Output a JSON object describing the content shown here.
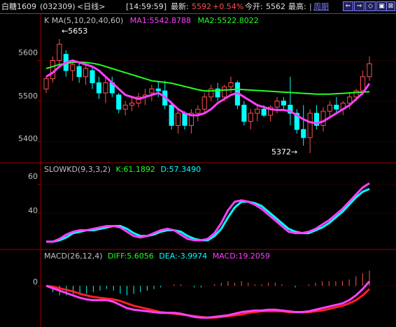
{
  "header": {
    "symbol": "白糖1609",
    "code": "(032309)",
    "period": "<日线>",
    "time": "[14:59:59]",
    "last_label": "最新:",
    "last_value": "5592",
    "change": "+0.54%",
    "open_label": "今开:",
    "open_value": "5562",
    "high_label": "最高:",
    "cycle_label": "周期",
    "buttons": [
      "⇐",
      "⇒",
      "◇",
      "▣",
      "⊠"
    ]
  },
  "colors": {
    "up": "#ff5050",
    "down": "#00ffff",
    "ma1": "#ff40ff",
    "ma2": "#22ff22",
    "grid": "#7a0000"
  },
  "kline": {
    "title": "K  MA(5,10,20,40,60)",
    "ma1": "MA1:5542.8788",
    "ma2": "MA2:5522.8022",
    "y_ticks": [
      "5600",
      "5500",
      "5400"
    ],
    "max_label": "←5653",
    "min_label": "5372→"
  },
  "kd": {
    "title": "SLOWKD(9,3,3,2)",
    "k": "K:61.1892",
    "d": "D:57.3490",
    "y_ticks": [
      "60",
      "40"
    ]
  },
  "macd": {
    "title": "MACD(26,12,4)",
    "diff": "DIFF:5.6056",
    "dea": "DEA:-3.9974",
    "macd": "MACD:19.2059",
    "y_ticks": [
      "0"
    ]
  },
  "chart_data": [
    {
      "type": "candlestick",
      "title": "K  MA(5,10,20,40,60)",
      "ylim": [
        5360,
        5680
      ],
      "candles": [
        {
          "o": 5530,
          "h": 5560,
          "l": 5520,
          "c": 5555
        },
        {
          "o": 5555,
          "h": 5610,
          "l": 5545,
          "c": 5600
        },
        {
          "o": 5600,
          "h": 5653,
          "l": 5585,
          "c": 5640
        },
        {
          "o": 5615,
          "h": 5625,
          "l": 5560,
          "c": 5575
        },
        {
          "o": 5575,
          "h": 5600,
          "l": 5550,
          "c": 5590
        },
        {
          "o": 5585,
          "h": 5595,
          "l": 5545,
          "c": 5560
        },
        {
          "o": 5560,
          "h": 5590,
          "l": 5540,
          "c": 5580
        },
        {
          "o": 5575,
          "h": 5585,
          "l": 5530,
          "c": 5545
        },
        {
          "o": 5545,
          "h": 5560,
          "l": 5505,
          "c": 5520
        },
        {
          "o": 5520,
          "h": 5560,
          "l": 5495,
          "c": 5545
        },
        {
          "o": 5545,
          "h": 5560,
          "l": 5510,
          "c": 5520
        },
        {
          "o": 5515,
          "h": 5520,
          "l": 5470,
          "c": 5480
        },
        {
          "o": 5480,
          "h": 5500,
          "l": 5465,
          "c": 5490
        },
        {
          "o": 5490,
          "h": 5510,
          "l": 5475,
          "c": 5495
        },
        {
          "o": 5495,
          "h": 5520,
          "l": 5485,
          "c": 5510
        },
        {
          "o": 5510,
          "h": 5530,
          "l": 5490,
          "c": 5515
        },
        {
          "o": 5520,
          "h": 5540,
          "l": 5500,
          "c": 5530
        },
        {
          "o": 5530,
          "h": 5550,
          "l": 5510,
          "c": 5525
        },
        {
          "o": 5525,
          "h": 5550,
          "l": 5480,
          "c": 5490
        },
        {
          "o": 5490,
          "h": 5500,
          "l": 5430,
          "c": 5440
        },
        {
          "o": 5440,
          "h": 5480,
          "l": 5420,
          "c": 5470
        },
        {
          "o": 5470,
          "h": 5475,
          "l": 5430,
          "c": 5440
        },
        {
          "o": 5440,
          "h": 5480,
          "l": 5420,
          "c": 5470
        },
        {
          "o": 5470,
          "h": 5490,
          "l": 5450,
          "c": 5480
        },
        {
          "o": 5480,
          "h": 5520,
          "l": 5470,
          "c": 5510
        },
        {
          "o": 5510,
          "h": 5540,
          "l": 5500,
          "c": 5530
        },
        {
          "o": 5530,
          "h": 5545,
          "l": 5500,
          "c": 5510
        },
        {
          "o": 5510,
          "h": 5540,
          "l": 5500,
          "c": 5535
        },
        {
          "o": 5535,
          "h": 5560,
          "l": 5520,
          "c": 5545
        },
        {
          "o": 5545,
          "h": 5550,
          "l": 5480,
          "c": 5490
        },
        {
          "o": 5490,
          "h": 5500,
          "l": 5440,
          "c": 5450
        },
        {
          "o": 5450,
          "h": 5480,
          "l": 5430,
          "c": 5470
        },
        {
          "o": 5470,
          "h": 5490,
          "l": 5450,
          "c": 5480
        },
        {
          "o": 5480,
          "h": 5490,
          "l": 5460,
          "c": 5465
        },
        {
          "o": 5465,
          "h": 5490,
          "l": 5450,
          "c": 5485
        },
        {
          "o": 5485,
          "h": 5510,
          "l": 5470,
          "c": 5500
        },
        {
          "o": 5500,
          "h": 5510,
          "l": 5480,
          "c": 5490
        },
        {
          "o": 5490,
          "h": 5560,
          "l": 5440,
          "c": 5470
        },
        {
          "o": 5470,
          "h": 5480,
          "l": 5420,
          "c": 5430
        },
        {
          "o": 5430,
          "h": 5490,
          "l": 5390,
          "c": 5410
        },
        {
          "o": 5410,
          "h": 5480,
          "l": 5372,
          "c": 5470
        },
        {
          "o": 5470,
          "h": 5490,
          "l": 5430,
          "c": 5440
        },
        {
          "o": 5440,
          "h": 5485,
          "l": 5425,
          "c": 5475
        },
        {
          "o": 5475,
          "h": 5500,
          "l": 5460,
          "c": 5490
        },
        {
          "o": 5490,
          "h": 5510,
          "l": 5470,
          "c": 5480
        },
        {
          "o": 5480,
          "h": 5500,
          "l": 5465,
          "c": 5495
        },
        {
          "o": 5495,
          "h": 5520,
          "l": 5480,
          "c": 5510
        },
        {
          "o": 5510,
          "h": 5530,
          "l": 5500,
          "c": 5525
        },
        {
          "o": 5525,
          "h": 5575,
          "l": 5515,
          "c": 5560
        },
        {
          "o": 5560,
          "h": 5610,
          "l": 5550,
          "c": 5592
        }
      ],
      "ma1": [
        5560,
        5570,
        5585,
        5595,
        5600,
        5595,
        5590,
        5585,
        5575,
        5560,
        5545,
        5530,
        5515,
        5510,
        5505,
        5510,
        5515,
        5520,
        5510,
        5495,
        5480,
        5470,
        5465,
        5465,
        5470,
        5480,
        5495,
        5505,
        5515,
        5520,
        5510,
        5500,
        5490,
        5485,
        5480,
        5478,
        5478,
        5475,
        5465,
        5455,
        5448,
        5445,
        5450,
        5460,
        5470,
        5480,
        5490,
        5505,
        5520,
        5543
      ],
      "ma2": [
        5580,
        5585,
        5590,
        5592,
        5595,
        5596,
        5595,
        5593,
        5590,
        5585,
        5580,
        5575,
        5570,
        5565,
        5560,
        5555,
        5550,
        5548,
        5546,
        5544,
        5540,
        5536,
        5532,
        5528,
        5525,
        5525,
        5526,
        5527,
        5528,
        5529,
        5528,
        5527,
        5526,
        5525,
        5524,
        5523,
        5522,
        5521,
        5520,
        5519,
        5518,
        5517,
        5517,
        5517,
        5518,
        5519,
        5520,
        5521,
        5522,
        5523
      ]
    },
    {
      "type": "line",
      "title": "SLOWKD(9,3,3,2)",
      "ylim": [
        17,
        67
      ],
      "series": [
        {
          "name": "K",
          "values": [
            20,
            20,
            22,
            25,
            27,
            28,
            28,
            29,
            30,
            31,
            31,
            30,
            27,
            24,
            23,
            24,
            26,
            28,
            29,
            28,
            25,
            22,
            21,
            21,
            22,
            26,
            33,
            42,
            48,
            49,
            48,
            46,
            43,
            39,
            35,
            31,
            27,
            26,
            26,
            27,
            29,
            32,
            35,
            39,
            43,
            48,
            53,
            58,
            61
          ]
        },
        {
          "name": "D",
          "values": [
            20,
            20,
            21,
            23,
            26,
            27,
            28,
            28,
            29,
            30,
            31,
            31,
            29,
            26,
            24,
            24,
            25,
            27,
            28,
            28,
            27,
            24,
            22,
            21,
            21,
            24,
            29,
            37,
            44,
            48,
            48,
            47,
            45,
            41,
            37,
            33,
            29,
            27,
            26,
            26,
            28,
            30,
            33,
            37,
            41,
            46,
            51,
            55,
            57
          ]
        }
      ]
    },
    {
      "type": "line",
      "title": "MACD(26,12,4)",
      "ylim": [
        -50,
        30
      ],
      "series": [
        {
          "name": "DIFF",
          "values": [
            0,
            -3,
            -6,
            -9,
            -12,
            -15,
            -17,
            -18,
            -18,
            -18,
            -20,
            -24,
            -28,
            -30,
            -31,
            -32,
            -33,
            -34,
            -34,
            -34,
            -35,
            -37,
            -39,
            -40,
            -40,
            -39,
            -38,
            -37,
            -35,
            -33,
            -32,
            -31,
            -31,
            -30,
            -30,
            -31,
            -32,
            -33,
            -33,
            -32,
            -30,
            -28,
            -26,
            -24,
            -22,
            -18,
            -12,
            -4,
            5.6
          ]
        },
        {
          "name": "DEA",
          "values": [
            0,
            -1,
            -3,
            -5,
            -7,
            -10,
            -12,
            -14,
            -15,
            -16,
            -17,
            -19,
            -22,
            -25,
            -27,
            -29,
            -31,
            -33,
            -34,
            -35,
            -36,
            -37,
            -38,
            -39,
            -40,
            -40,
            -39,
            -38,
            -37,
            -36,
            -34,
            -33,
            -32,
            -32,
            -32,
            -32,
            -33,
            -33,
            -33,
            -33,
            -32,
            -31,
            -29,
            -27,
            -25,
            -22,
            -18,
            -12,
            -4.0
          ]
        },
        {
          "name": "MACD",
          "values": [
            0,
            -8,
            -12,
            -12,
            -10,
            -10,
            -10,
            -8,
            -6,
            -4,
            -6,
            -10,
            -12,
            -10,
            -8,
            -6,
            -4,
            -2,
            0,
            2,
            2,
            0,
            -2,
            -2,
            0,
            2,
            4,
            6,
            4,
            6,
            4,
            2,
            2,
            4,
            4,
            2,
            0,
            -2,
            0,
            2,
            4,
            6,
            6,
            6,
            6,
            8,
            12,
            16,
            19.2
          ]
        }
      ]
    }
  ]
}
